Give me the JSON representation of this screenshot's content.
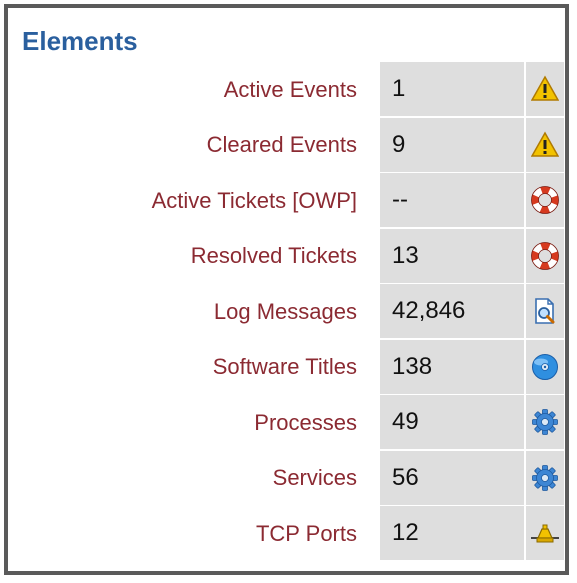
{
  "panel": {
    "title": "Elements",
    "rows": [
      {
        "label": "Active Events",
        "value": "1",
        "icon": "warning-icon"
      },
      {
        "label": "Cleared Events",
        "value": "9",
        "icon": "warning-icon"
      },
      {
        "label": "Active Tickets [OWP]",
        "value": "--",
        "icon": "lifebuoy-icon"
      },
      {
        "label": "Resolved Tickets",
        "value": "13",
        "icon": "lifebuoy-icon"
      },
      {
        "label": "Log Messages",
        "value": "42,846",
        "icon": "document-search-icon"
      },
      {
        "label": "Software Titles",
        "value": "138",
        "icon": "disc-icon"
      },
      {
        "label": "Processes",
        "value": "49",
        "icon": "gear-icon"
      },
      {
        "label": "Services",
        "value": "56",
        "icon": "gear-icon"
      },
      {
        "label": "TCP Ports",
        "value": "12",
        "icon": "network-port-icon"
      }
    ]
  },
  "colors": {
    "title": "#2a5f9e",
    "label": "#8b2a32",
    "cell_bg": "#dedede",
    "border": "#5a5a5a"
  }
}
